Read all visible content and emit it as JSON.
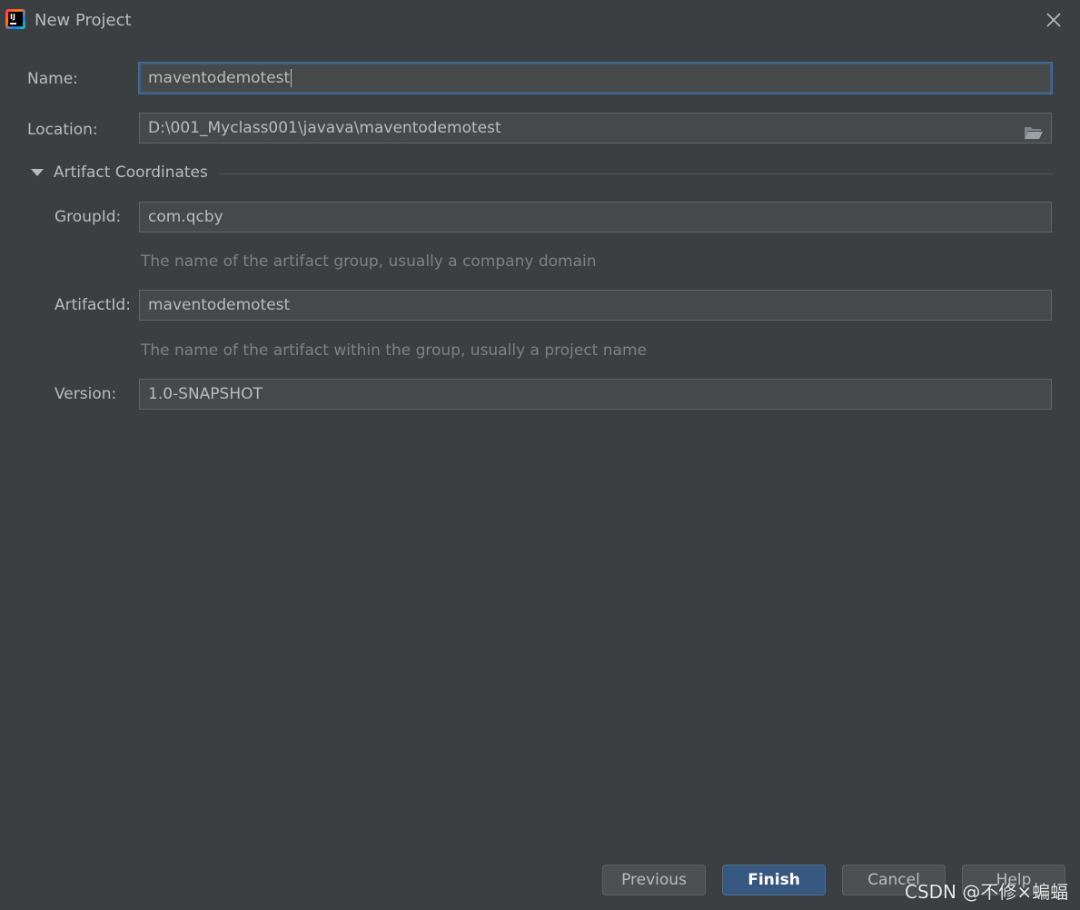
{
  "window": {
    "title": "New Project",
    "app_icon_text": "IJ"
  },
  "form": {
    "name_label": "Name:",
    "name_value": "maventodemotest",
    "location_label": "Location:",
    "location_value": "D:\\001_Myclass001\\javava\\maventodemotest",
    "section_title": "Artifact Coordinates",
    "group_label": "GroupId:",
    "group_value": "com.qcby",
    "group_hint": "The name of the artifact group, usually a company domain",
    "artifact_label": "ArtifactId:",
    "artifact_value": "maventodemotest",
    "artifact_hint": "The name of the artifact within the group, usually a project name",
    "version_label": "Version:",
    "version_value": "1.0-SNAPSHOT"
  },
  "buttons": {
    "previous": "Previous",
    "finish": "Finish",
    "cancel": "Cancel",
    "help": "Help"
  },
  "watermark": "CSDN @不修×蝙蝠",
  "colors": {
    "background": "#3c3f41",
    "field_bg": "#45494a",
    "text": "#bbbbbb",
    "hint": "#808080",
    "focus_border": "#3d6185",
    "primary_button": "#365880"
  }
}
